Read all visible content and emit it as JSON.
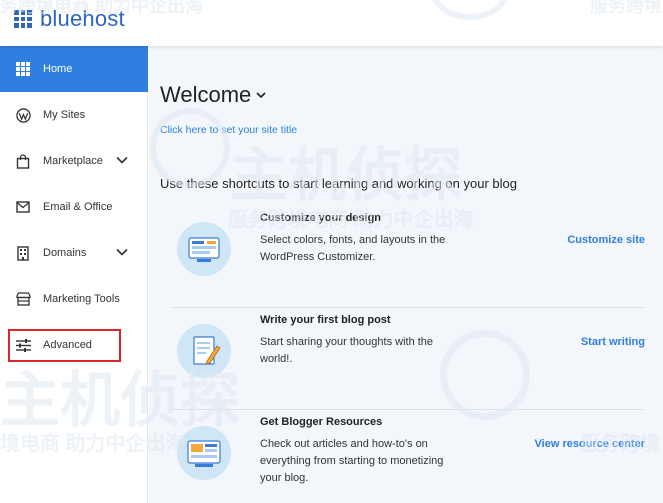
{
  "brand": {
    "name": "bluehost",
    "color": "#2e66ba"
  },
  "sidebar": {
    "items": [
      {
        "label": "Home",
        "icon": "bluehost-icon",
        "active": true
      },
      {
        "label": "My Sites",
        "icon": "wordpress-icon"
      },
      {
        "label": "Marketplace",
        "icon": "shopping-bag-icon",
        "expandable": true
      },
      {
        "label": "Email & Office",
        "icon": "envelope-icon"
      },
      {
        "label": "Domains",
        "icon": "building-icon",
        "expandable": true
      },
      {
        "label": "Marketing Tools",
        "icon": "storefront-icon"
      },
      {
        "label": "Advanced",
        "icon": "sliders-icon",
        "highlighted": true
      }
    ]
  },
  "main": {
    "welcome": "Welcome",
    "site_title_link": "Click here to set your site title",
    "shortcuts_heading": "Use these shortcuts to start learning and working on your blog",
    "cards": [
      {
        "title": "Customize your design",
        "description": "Select colors, fonts, and layouts in the WordPress Customizer.",
        "link": "Customize site",
        "icon": "design-illustration-icon"
      },
      {
        "title": "Write your first blog post",
        "description": "Start sharing your thoughts with the world!.",
        "link": "Start writing",
        "icon": "blog-post-illustration-icon"
      },
      {
        "title": "Get Blogger Resources",
        "description": "Check out articles and how-to's on everything from starting to monetizing your blog.",
        "link": "View resource center",
        "icon": "resources-illustration-icon"
      }
    ]
  },
  "watermark": {
    "big": "主机侦探",
    "small": "服务跨境电商 助力中企出海",
    "small_left": "境电商 助力中企出海",
    "small_right": "服务跨境",
    "top_left": "务跨境电商 助力中企出海",
    "top_right": "服务跨境"
  },
  "colors": {
    "accent": "#2e7fe0",
    "highlight": "#d9262a",
    "main_bg": "#f3f6fa"
  }
}
